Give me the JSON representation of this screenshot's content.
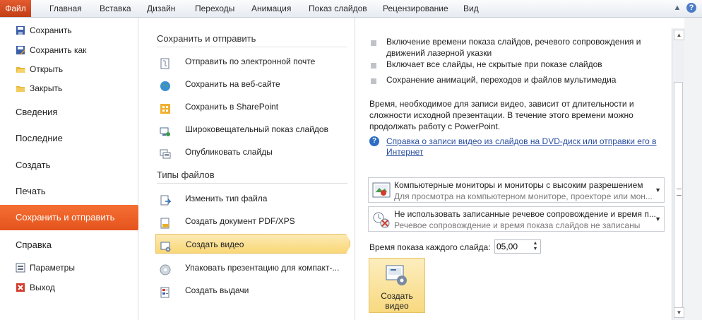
{
  "ribbon": {
    "tabs": [
      "Файл",
      "Главная",
      "Вставка",
      "Дизайн",
      "Переходы",
      "Анимация",
      "Показ слайдов",
      "Рецензирование",
      "Вид"
    ],
    "window_controls": [
      "minimize-icon",
      "help-icon"
    ]
  },
  "leftnav": {
    "small_top": [
      {
        "label": "Сохранить",
        "icon": "save-icon"
      },
      {
        "label": "Сохранить как",
        "icon": "save-as-icon"
      },
      {
        "label": "Открыть",
        "icon": "open-folder-icon"
      },
      {
        "label": "Закрыть",
        "icon": "close-folder-icon"
      }
    ],
    "big": [
      "Сведения",
      "Последние",
      "Создать",
      "Печать",
      "Сохранить и отправить",
      "Справка"
    ],
    "active": "Сохранить и отправить",
    "small_bottom": [
      {
        "label": "Параметры",
        "icon": "options-icon"
      },
      {
        "label": "Выход",
        "icon": "exit-icon"
      }
    ]
  },
  "middle": {
    "section1": "Сохранить и отправить",
    "items1": [
      {
        "label": "Отправить по электронной почте",
        "icon": "email-icon"
      },
      {
        "label": "Сохранить на веб-сайте",
        "icon": "web-globe-icon"
      },
      {
        "label": "Сохранить в SharePoint",
        "icon": "sharepoint-icon"
      },
      {
        "label": "Широковещательный показ слайдов",
        "icon": "broadcast-icon"
      },
      {
        "label": "Опубликовать слайды",
        "icon": "publish-slides-icon"
      }
    ],
    "section2": "Типы файлов",
    "items2": [
      {
        "label": "Изменить тип файла",
        "icon": "change-file-type-icon"
      },
      {
        "label": "Создать документ PDF/XPS",
        "icon": "pdf-icon"
      },
      {
        "label": "Создать видео",
        "icon": "video-icon"
      },
      {
        "label": "Упаковать презентацию для компакт-...",
        "icon": "package-cd-icon"
      },
      {
        "label": "Создать выдачи",
        "icon": "handouts-icon"
      }
    ],
    "selected": "Создать видео"
  },
  "right": {
    "bullets": [
      "Включение времени показа слайдов, речевого сопровождения и движений лазерной указки",
      "Включает все слайды, не скрытые при показе слайдов",
      "Сохранение анимаций, переходов и файлов мультимедиа"
    ],
    "paragraph": "Время, необходимое для записи видео, зависит от длительности и сложности исходной презентации. В течение этого времени можно продолжать работу с PowerPoint.",
    "help_link": "Справка о записи видео из слайдов на DVD-диск или отправки его в Интернет",
    "dropdown1": {
      "title": "Компьютерные мониторы и мониторы с высоким разрешением",
      "subtitle": "Для просмотра на компьютерном мониторе, проекторе или мон..."
    },
    "dropdown2": {
      "title": "Не использовать записанные речевое сопровождение и время п...",
      "subtitle": "Речевое сопровождение и время показа слайдов не записаны"
    },
    "time_label": "Время показа каждого слайда:",
    "time_value": "05,00",
    "create_button": "Создать видео"
  }
}
